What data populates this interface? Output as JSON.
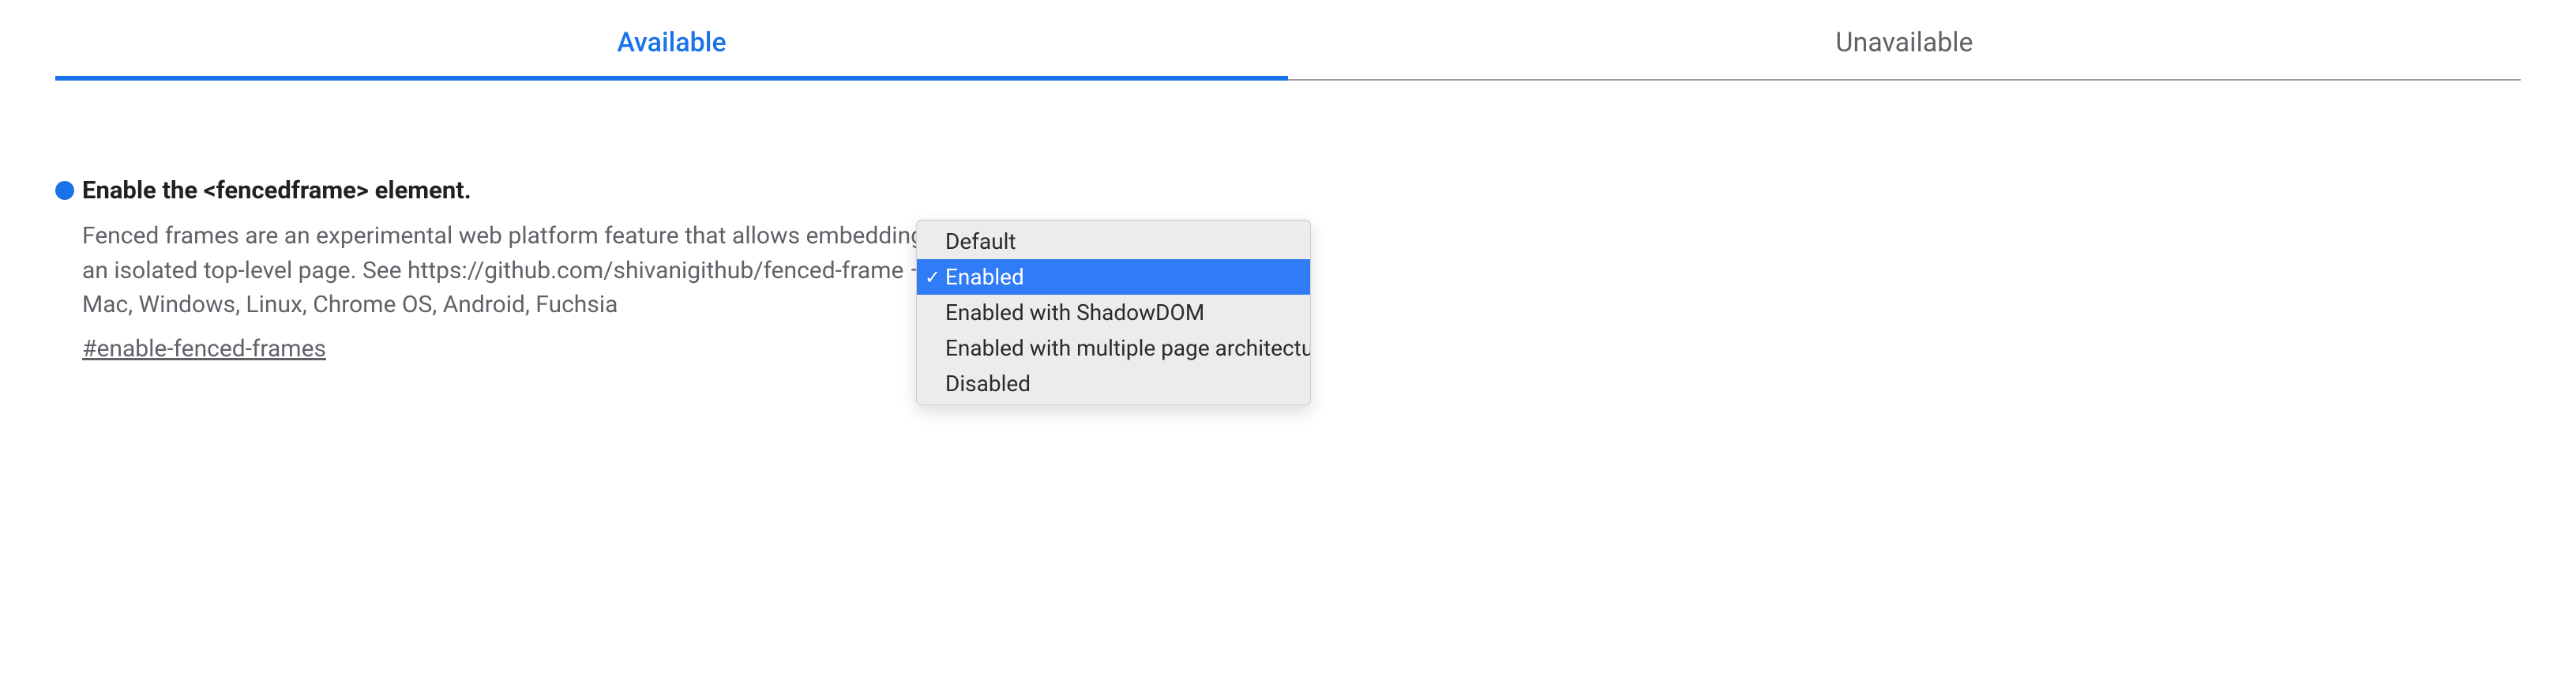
{
  "tabs": {
    "available": "Available",
    "unavailable": "Unavailable"
  },
  "flag": {
    "title": "Enable the <fencedframe> element.",
    "description": "Fenced frames are an experimental web platform feature that allows embedding an isolated top-level page. See https://github.com/shivanigithub/fenced-frame – Mac, Windows, Linux, Chrome OS, Android, Fuchsia",
    "hash": "#enable-fenced-frames"
  },
  "dropdown": {
    "options": {
      "default": "Default",
      "enabled": "Enabled",
      "enabled_shadowdom": "Enabled with ShadowDOM",
      "enabled_mpa": "Enabled with multiple page architecture",
      "disabled": "Disabled"
    },
    "selected": "Enabled"
  }
}
